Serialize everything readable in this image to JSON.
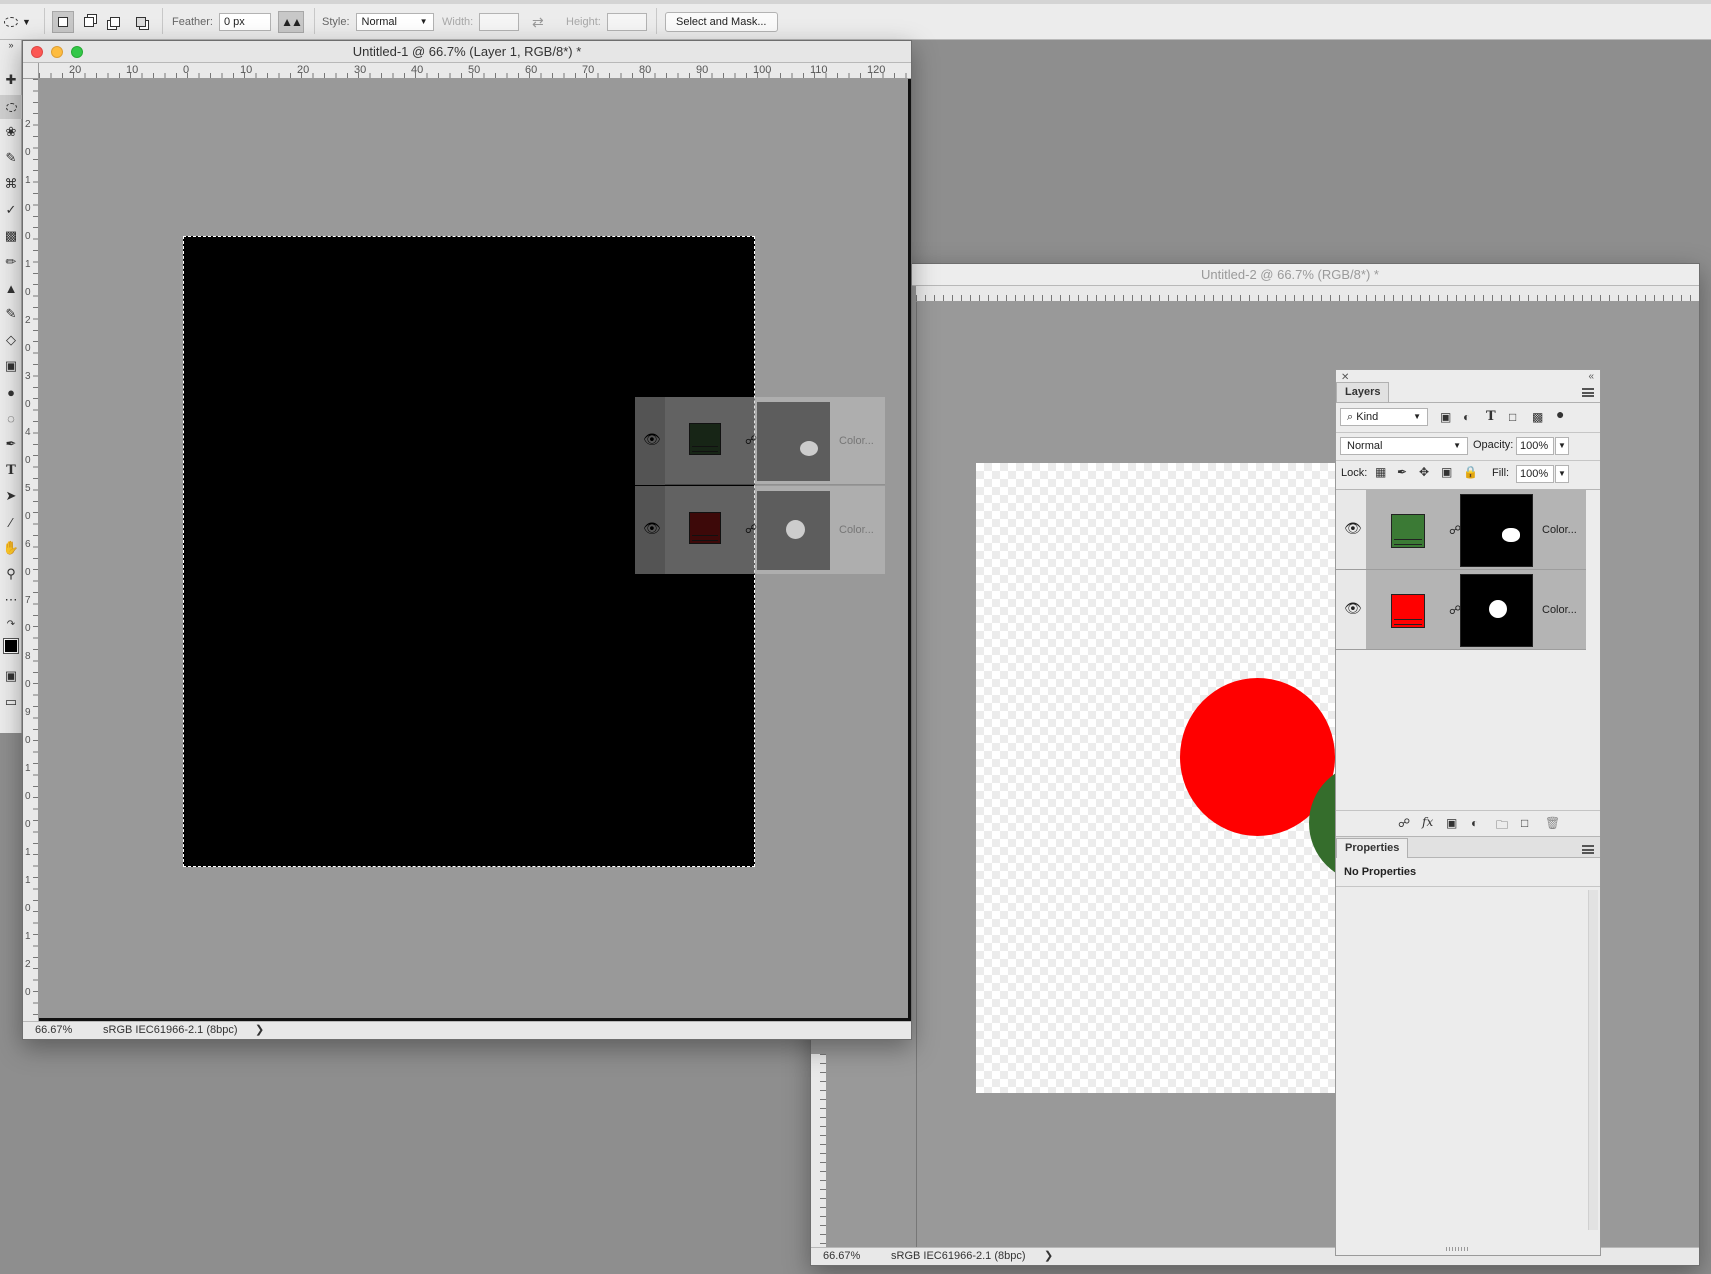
{
  "options_bar": {
    "feather_label": "Feather:",
    "feather_value": "0 px",
    "style_label": "Style:",
    "style_value": "Normal",
    "width_label": "Width:",
    "height_label": "Height:",
    "select_mask_label": "Select and Mask..."
  },
  "window1": {
    "title": "Untitled-1 @ 66.7% (Layer 1, RGB/8*) *",
    "zoom": "66.67%",
    "profile": "sRGB IEC61966-2.1 (8bpc)",
    "ruler_h": [
      "20",
      "10",
      "0",
      "10",
      "20",
      "30",
      "40",
      "50",
      "60",
      "70",
      "80",
      "90",
      "100",
      "110",
      "120"
    ],
    "ruler_v": [
      "2",
      "0",
      "1",
      "0",
      "0",
      "1",
      "0",
      "2",
      "0",
      "3",
      "0",
      "4",
      "0",
      "5",
      "0",
      "6",
      "0",
      "7",
      "0",
      "8",
      "0",
      "9",
      "0",
      "1",
      "0",
      "0",
      "1",
      "1",
      "0",
      "1",
      "2",
      "0"
    ],
    "ghost_layers": [
      {
        "name": "Color...",
        "color": "#2f4a2c"
      },
      {
        "name": "Color...",
        "color": "#7a1212"
      }
    ]
  },
  "window2": {
    "title": "Untitled-2 @ 66.7% (RGB/8*) *",
    "zoom": "66.67%",
    "profile": "sRGB IEC61966-2.1 (8bpc)"
  },
  "layers_panel": {
    "tab": "Layers",
    "filter_kind": "Kind",
    "blend_mode": "Normal",
    "opacity_label": "Opacity:",
    "opacity_value": "100%",
    "lock_label": "Lock:",
    "fill_label": "Fill:",
    "fill_value": "100%",
    "layers": [
      {
        "name": "Color...",
        "color": "#3b7a35"
      },
      {
        "name": "Color...",
        "color": "#ff0000"
      }
    ]
  },
  "properties_panel": {
    "tab": "Properties",
    "empty_text": "No Properties"
  },
  "colors": {
    "red_circle": "#ff0000",
    "green_circle": "#356d2c",
    "workspace": "#8e8e8e"
  }
}
